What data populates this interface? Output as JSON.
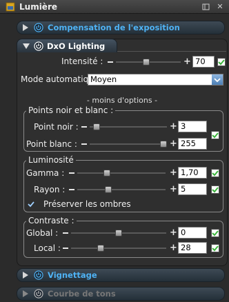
{
  "window": {
    "title": "Lumière"
  },
  "sections": {
    "compensation": {
      "label": "Compensation de l'exposition"
    },
    "dxo_lighting": {
      "label": "DxO Lighting"
    },
    "vignettage": {
      "label": "Vignettage"
    },
    "courbe": {
      "label": "Courbe de tons"
    }
  },
  "dxo": {
    "intensity": {
      "label": "Intensité :",
      "value": "70",
      "level": 0.47,
      "checked": true
    },
    "mode": {
      "label": "Mode automatique :",
      "value": "Moyen"
    },
    "less_options": "- moins d'options -",
    "points_group": {
      "title": "Points noir et blanc :",
      "black": {
        "label": "Point noir :",
        "value": "3",
        "level": 0.05
      },
      "white": {
        "label": "Point blanc :",
        "value": "255",
        "level": 1.0
      },
      "checked": true
    },
    "luminosity_group": {
      "title": "Luminosité",
      "gamma": {
        "label": "Gamma :",
        "value": "1,70",
        "level": 0.32,
        "checked": true
      },
      "radius": {
        "label": "Rayon :",
        "value": "5",
        "level": 0.34,
        "checked": true
      },
      "preserve_shadows": {
        "label": "Préserver les ombres",
        "checked": true
      }
    },
    "contrast_group": {
      "title": "Contraste :",
      "global": {
        "label": "Global :",
        "value": "0",
        "level": 0.5,
        "checked": true
      },
      "local": {
        "label": "Local :",
        "value": "28",
        "level": 0.3,
        "checked": true
      }
    }
  },
  "colors": {
    "accent_blue": "#4fb3f5",
    "check_green": "#3cb43c"
  }
}
